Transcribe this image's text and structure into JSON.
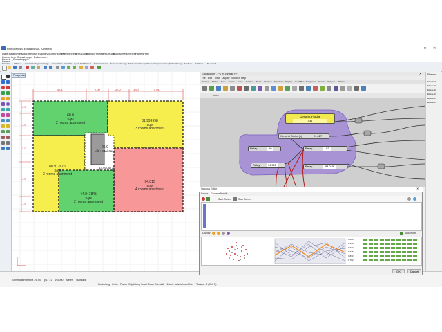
{
  "window": {
    "title": "Rhinoceros 6 Educational - [Untitled]",
    "menus": [
      "Datei",
      "Bearbeiten",
      "Ansicht",
      "Kurve",
      "Fläche",
      "Volumenkörper",
      "Polygonnetz",
      "Bemaßung",
      "Transformieren",
      "Werkzeuge",
      "Analysieren",
      "Rendern",
      "Panels",
      "Hilfe"
    ],
    "command_history": [
      "Konvertiere Grasshopper Dokument...",
      "Befehl: _Grasshopper"
    ],
    "command_prompt": "Befehl:",
    "toolbar_tabs": [
      "Standard",
      "CPlanes",
      "Ansicht festlegen",
      "Anzeige",
      "Auswählen",
      "Ansichts-Layout",
      "Sichtbarkeit",
      "Transformieren",
      "Kurvenwerkzeuge",
      "Flächenwerkzeuge",
      "Volumenkörperwerkzeuge",
      "Netzwerkzeuge",
      "Rendern",
      "Zeichnen",
      "Neu in V6"
    ]
  },
  "viewport": {
    "label": "Perspektive",
    "tabs": [
      "Perspektive",
      "Front",
      "Rechts",
      "Oben"
    ],
    "dimensions_top": [
      "4.01",
      "2.00",
      "2.00",
      "1.60",
      "4.01"
    ],
    "dimensions_left": [
      "0.5",
      "3.5",
      "3.0",
      "3.5",
      "1.5"
    ],
    "rooms": [
      {
        "area": "60.0",
        "unit": "SqM",
        "label": "2 rooms apartment",
        "color": "#62d26f"
      },
      {
        "area": "81.999998",
        "unit": "SqM",
        "label": "3 rooms apartment",
        "color": "#f6ee4d"
      },
      {
        "area": "25.0",
        "unit": "",
        "label": "Lift + Staircase",
        "color": "#9a9a9a"
      },
      {
        "area": "80.917676",
        "unit": "SqM",
        "label": "3 rooms apartment",
        "color": "#f6ee4d"
      },
      {
        "area": "44.047845",
        "unit": "SqM",
        "label": "2 rooms apartment",
        "color": "#62d26f"
      },
      {
        "area": "94.015",
        "unit": "SqM",
        "label": "4 rooms apartment",
        "color": "#f79797"
      }
    ],
    "corridor_area": "14.010471"
  },
  "statusbar": {
    "cells": [
      "Konstruktionsebene",
      "x  -20.94",
      "y  17.72",
      "z  0.000",
      "Meter",
      "Standard",
      "Rasterfang",
      "Ortho",
      "Planar",
      "Objektfang",
      "Smart Track",
      "Gumball",
      "Historie aufzeichnen",
      "Filter",
      "Tastatur: 2 (Ctrl+P)"
    ]
  },
  "grasshopper": {
    "title": "Grasshopper - PS_R-Variante FF",
    "menus": [
      "File",
      "Edit",
      "View",
      "Display",
      "Solution",
      "Help"
    ],
    "tabs": [
      "Params",
      "Maths",
      "Sets",
      "Vector",
      "Curve",
      "Surface",
      "Mesh",
      "Intersect",
      "Transform",
      "Display",
      "LunchBox",
      "Kangaroo2",
      "Human",
      "Octopus",
      "Wallacei"
    ],
    "zoom": "100%",
    "nodes": {
      "gesamt_title": "Gesamt Fläche",
      "gesamt_value": "431",
      "gesamt_breite_label": "Gesamt Breite (x)",
      "gesamt_breite_value": "24.027",
      "relay1_label": "Relay",
      "relay1_value": "60",
      "relay2_label": "Relay",
      "relay2_value": "82",
      "relay3_label": "Relay",
      "relay3_value": "94.711",
      "relay4_label": "Relay",
      "relay4_value": "94.015"
    }
  },
  "optimizer": {
    "title": "Octopus Editor",
    "tabs": [
      "Solver",
      "Genome",
      "Results"
    ],
    "start_label": "Start Solver",
    "stop_label": "Stop Solver",
    "display_label": "Display",
    "ok_label": "OK",
    "cancel_label": "Cancel",
    "showroom_label": "Showroom",
    "slider_labels": [
      "1.000",
      "0.958",
      "0.917",
      "0.875",
      "0.833",
      "0.792"
    ]
  },
  "right_panel": {
    "title": "Ebenen",
    "items": [
      "Standard",
      "Ebene 01",
      "Ebene 02",
      "Ebene 03",
      "Ebene 04",
      "Ebene 05"
    ]
  }
}
